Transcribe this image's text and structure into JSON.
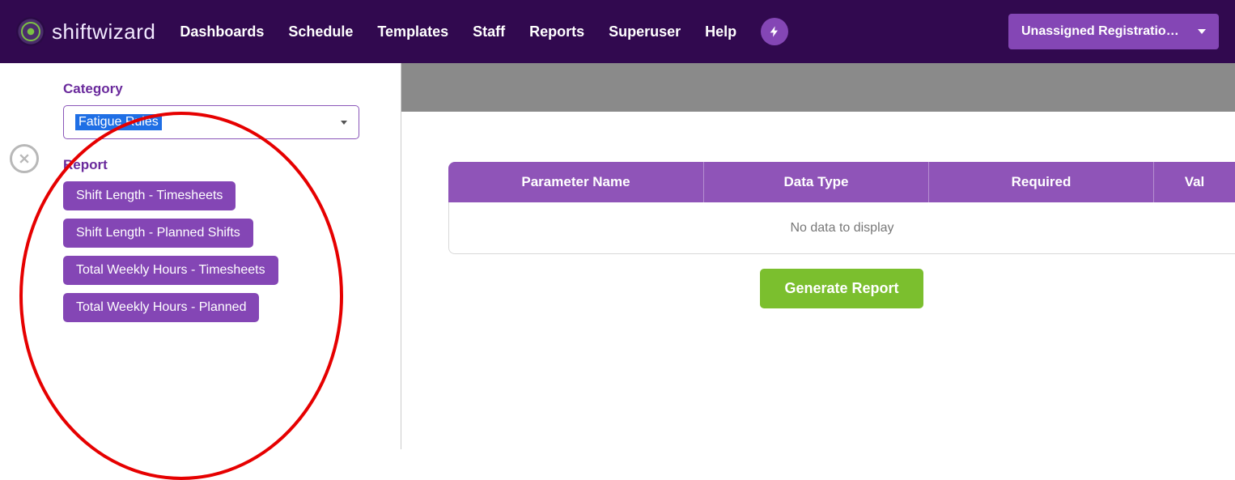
{
  "brand": "shiftwizard",
  "nav": {
    "items": [
      "Dashboards",
      "Schedule",
      "Templates",
      "Staff",
      "Reports",
      "Superuser",
      "Help"
    ]
  },
  "user_dropdown": "Unassigned Registratio…",
  "sidebar": {
    "category_label": "Category",
    "category_value": "Fatigue Rules",
    "report_label": "Report",
    "reports": [
      "Shift Length - Timesheets",
      "Shift Length - Planned Shifts",
      "Total Weekly Hours - Timesheets",
      "Total Weekly Hours - Planned"
    ]
  },
  "table": {
    "headers": [
      "Parameter Name",
      "Data Type",
      "Required",
      "Val"
    ],
    "empty_text": "No data to display"
  },
  "generate_label": "Generate Report"
}
